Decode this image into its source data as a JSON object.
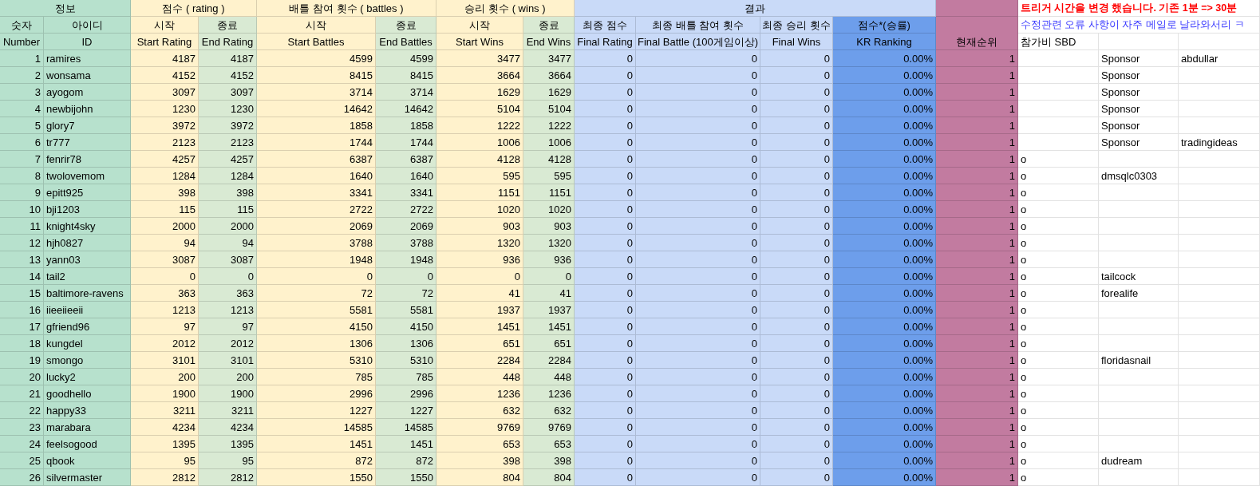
{
  "sheet": {
    "group_headers": [
      "정보",
      "점수 ( rating )",
      "배틀 참여 횟수 ( battles )",
      "승리 횟수 ( wins )",
      "결과"
    ],
    "notice": "트리거 시간을 변경 했습니다. 기존 1분 => 30분",
    "korean_headers": [
      "숫자",
      "아이디",
      "시작",
      "종료",
      "시작",
      "종료",
      "시작",
      "종료",
      "최종 점수",
      "최종 배틀 참여 횟수",
      "최종 승리 횟수",
      "점수*(승률)"
    ],
    "notice_2": "수정관련 오류 사항이 자주 메일로 날라와서리 ㅋ",
    "current_rank_header": "현재순위",
    "english_headers": [
      "Number",
      "ID",
      "Start Rating",
      "End Rating",
      "Start Battles",
      "End Battles",
      "Start Wins",
      "End Wins",
      "Final Rating",
      "Final Battle (100게임이상)",
      "Final Wins",
      "KR Ranking"
    ],
    "fee_header": "참가비 SBD",
    "rows": [
      {
        "number": "1",
        "id": "ramires",
        "start_rating": "4187",
        "end_rating": "4187",
        "start_battles": "4599",
        "end_battles": "4599",
        "start_wins": "3477",
        "end_wins": "3477",
        "final_rating": "0",
        "final_battle": "0",
        "final_wins": "0",
        "kr_ranking": "0.00%",
        "current_rank": "1",
        "column_15": "Sponsor",
        "column_16": "abdullar"
      },
      {
        "number": "2",
        "id": "wonsama",
        "start_rating": "4152",
        "end_rating": "4152",
        "start_battles": "8415",
        "end_battles": "8415",
        "start_wins": "3664",
        "end_wins": "3664",
        "final_rating": "0",
        "final_battle": "0",
        "final_wins": "0",
        "kr_ranking": "0.00%",
        "current_rank": "1",
        "column_15": "Sponsor"
      },
      {
        "number": "3",
        "id": "ayogom",
        "start_rating": "3097",
        "end_rating": "3097",
        "start_battles": "3714",
        "end_battles": "3714",
        "start_wins": "1629",
        "end_wins": "1629",
        "final_rating": "0",
        "final_battle": "0",
        "final_wins": "0",
        "kr_ranking": "0.00%",
        "current_rank": "1",
        "column_15": "Sponsor"
      },
      {
        "number": "4",
        "id": "newbijohn",
        "start_rating": "1230",
        "end_rating": "1230",
        "start_battles": "14642",
        "end_battles": "14642",
        "start_wins": "5104",
        "end_wins": "5104",
        "final_rating": "0",
        "final_battle": "0",
        "final_wins": "0",
        "kr_ranking": "0.00%",
        "current_rank": "1",
        "column_15": "Sponsor"
      },
      {
        "number": "5",
        "id": "glory7",
        "start_rating": "3972",
        "end_rating": "3972",
        "start_battles": "1858",
        "end_battles": "1858",
        "start_wins": "1222",
        "end_wins": "1222",
        "final_rating": "0",
        "final_battle": "0",
        "final_wins": "0",
        "kr_ranking": "0.00%",
        "current_rank": "1",
        "column_15": "Sponsor"
      },
      {
        "number": "6",
        "id": "tr777",
        "start_rating": "2123",
        "end_rating": "2123",
        "start_battles": "1744",
        "end_battles": "1744",
        "start_wins": "1006",
        "end_wins": "1006",
        "final_rating": "0",
        "final_battle": "0",
        "final_wins": "0",
        "kr_ranking": "0.00%",
        "current_rank": "1",
        "column_15": "Sponsor",
        "column_16": "tradingideas"
      },
      {
        "number": "7",
        "id": "fenrir78",
        "start_rating": "4257",
        "end_rating": "4257",
        "start_battles": "6387",
        "end_battles": "6387",
        "start_wins": "4128",
        "end_wins": "4128",
        "final_rating": "0",
        "final_battle": "0",
        "final_wins": "0",
        "kr_ranking": "0.00%",
        "current_rank": "1",
        "column_14": "o"
      },
      {
        "number": "8",
        "id": "twolovemom",
        "start_rating": "1284",
        "end_rating": "1284",
        "start_battles": "1640",
        "end_battles": "1640",
        "start_wins": "595",
        "end_wins": "595",
        "final_rating": "0",
        "final_battle": "0",
        "final_wins": "0",
        "kr_ranking": "0.00%",
        "current_rank": "1",
        "column_14": "o",
        "column_15": "dmsqlc0303"
      },
      {
        "number": "9",
        "id": "epitt925",
        "start_rating": "398",
        "end_rating": "398",
        "start_battles": "3341",
        "end_battles": "3341",
        "start_wins": "1151",
        "end_wins": "1151",
        "final_rating": "0",
        "final_battle": "0",
        "final_wins": "0",
        "kr_ranking": "0.00%",
        "current_rank": "1",
        "column_14": "o"
      },
      {
        "number": "10",
        "id": "bji1203",
        "start_rating": "115",
        "end_rating": "115",
        "start_battles": "2722",
        "end_battles": "2722",
        "start_wins": "1020",
        "end_wins": "1020",
        "final_rating": "0",
        "final_battle": "0",
        "final_wins": "0",
        "kr_ranking": "0.00%",
        "current_rank": "1",
        "column_14": "o"
      },
      {
        "number": "11",
        "id": "knight4sky",
        "start_rating": "2000",
        "end_rating": "2000",
        "start_battles": "2069",
        "end_battles": "2069",
        "start_wins": "903",
        "end_wins": "903",
        "final_rating": "0",
        "final_battle": "0",
        "final_wins": "0",
        "kr_ranking": "0.00%",
        "current_rank": "1",
        "column_14": "o"
      },
      {
        "number": "12",
        "id": "hjh0827",
        "start_rating": "94",
        "end_rating": "94",
        "start_battles": "3788",
        "end_battles": "3788",
        "start_wins": "1320",
        "end_wins": "1320",
        "final_rating": "0",
        "final_battle": "0",
        "final_wins": "0",
        "kr_ranking": "0.00%",
        "current_rank": "1",
        "column_14": "o"
      },
      {
        "number": "13",
        "id": "yann03",
        "start_rating": "3087",
        "end_rating": "3087",
        "start_battles": "1948",
        "end_battles": "1948",
        "start_wins": "936",
        "end_wins": "936",
        "final_rating": "0",
        "final_battle": "0",
        "final_wins": "0",
        "kr_ranking": "0.00%",
        "current_rank": "1",
        "column_14": "o"
      },
      {
        "number": "14",
        "id": "tail2",
        "start_rating": "0",
        "end_rating": "0",
        "start_battles": "0",
        "end_battles": "0",
        "start_wins": "0",
        "end_wins": "0",
        "final_rating": "0",
        "final_battle": "0",
        "final_wins": "0",
        "kr_ranking": "0.00%",
        "current_rank": "1",
        "column_14": "o",
        "column_15": "tailcock"
      },
      {
        "number": "15",
        "id": "baltimore-ravens",
        "start_rating": "363",
        "end_rating": "363",
        "start_battles": "72",
        "end_battles": "72",
        "start_wins": "41",
        "end_wins": "41",
        "final_rating": "0",
        "final_battle": "0",
        "final_wins": "0",
        "kr_ranking": "0.00%",
        "current_rank": "1",
        "column_14": "o",
        "column_15": "forealife"
      },
      {
        "number": "16",
        "id": "iieeiieeii",
        "start_rating": "1213",
        "end_rating": "1213",
        "start_battles": "5581",
        "end_battles": "5581",
        "start_wins": "1937",
        "end_wins": "1937",
        "final_rating": "0",
        "final_battle": "0",
        "final_wins": "0",
        "kr_ranking": "0.00%",
        "current_rank": "1",
        "column_14": "o"
      },
      {
        "number": "17",
        "id": "gfriend96",
        "start_rating": "97",
        "end_rating": "97",
        "start_battles": "4150",
        "end_battles": "4150",
        "start_wins": "1451",
        "end_wins": "1451",
        "final_rating": "0",
        "final_battle": "0",
        "final_wins": "0",
        "kr_ranking": "0.00%",
        "current_rank": "1",
        "column_14": "o"
      },
      {
        "number": "18",
        "id": "kungdel",
        "start_rating": "2012",
        "end_rating": "2012",
        "start_battles": "1306",
        "end_battles": "1306",
        "start_wins": "651",
        "end_wins": "651",
        "final_rating": "0",
        "final_battle": "0",
        "final_wins": "0",
        "kr_ranking": "0.00%",
        "current_rank": "1",
        "column_14": "o"
      },
      {
        "number": "19",
        "id": "smongo",
        "start_rating": "3101",
        "end_rating": "3101",
        "start_battles": "5310",
        "end_battles": "5310",
        "start_wins": "2284",
        "end_wins": "2284",
        "final_rating": "0",
        "final_battle": "0",
        "final_wins": "0",
        "kr_ranking": "0.00%",
        "current_rank": "1",
        "column_14": "o",
        "column_15": "floridasnail"
      },
      {
        "number": "20",
        "id": "lucky2",
        "start_rating": "200",
        "end_rating": "200",
        "start_battles": "785",
        "end_battles": "785",
        "start_wins": "448",
        "end_wins": "448",
        "final_rating": "0",
        "final_battle": "0",
        "final_wins": "0",
        "kr_ranking": "0.00%",
        "current_rank": "1",
        "column_14": "o"
      },
      {
        "number": "21",
        "id": "goodhello",
        "start_rating": "1900",
        "end_rating": "1900",
        "start_battles": "2996",
        "end_battles": "2996",
        "start_wins": "1236",
        "end_wins": "1236",
        "final_rating": "0",
        "final_battle": "0",
        "final_wins": "0",
        "kr_ranking": "0.00%",
        "current_rank": "1",
        "column_14": "o"
      },
      {
        "number": "22",
        "id": "happy33",
        "start_rating": "3211",
        "end_rating": "3211",
        "start_battles": "1227",
        "end_battles": "1227",
        "start_wins": "632",
        "end_wins": "632",
        "final_rating": "0",
        "final_battle": "0",
        "final_wins": "0",
        "kr_ranking": "0.00%",
        "current_rank": "1",
        "column_14": "o"
      },
      {
        "number": "23",
        "id": "marabara",
        "start_rating": "4234",
        "end_rating": "4234",
        "start_battles": "14585",
        "end_battles": "14585",
        "start_wins": "9769",
        "end_wins": "9769",
        "final_rating": "0",
        "final_battle": "0",
        "final_wins": "0",
        "kr_ranking": "0.00%",
        "current_rank": "1",
        "column_14": "o"
      },
      {
        "number": "24",
        "id": "feelsogood",
        "start_rating": "1395",
        "end_rating": "1395",
        "start_battles": "1451",
        "end_battles": "1451",
        "start_wins": "653",
        "end_wins": "653",
        "final_rating": "0",
        "final_battle": "0",
        "final_wins": "0",
        "kr_ranking": "0.00%",
        "current_rank": "1",
        "column_14": "o"
      },
      {
        "number": "25",
        "id": "qbook",
        "start_rating": "95",
        "end_rating": "95",
        "start_battles": "872",
        "end_battles": "872",
        "start_wins": "398",
        "end_wins": "398",
        "final_rating": "0",
        "final_battle": "0",
        "final_wins": "0",
        "kr_ranking": "0.00%",
        "current_rank": "1",
        "column_14": "o",
        "column_15": "dudream"
      },
      {
        "number": "26",
        "id": "silvermaster",
        "start_rating": "2812",
        "end_rating": "2812",
        "start_battles": "1550",
        "end_battles": "1550",
        "start_wins": "804",
        "end_wins": "804",
        "final_rating": "0",
        "final_battle": "0",
        "final_wins": "0",
        "kr_ranking": "0.00%",
        "current_rank": "1",
        "column_14": "o"
      }
    ]
  }
}
